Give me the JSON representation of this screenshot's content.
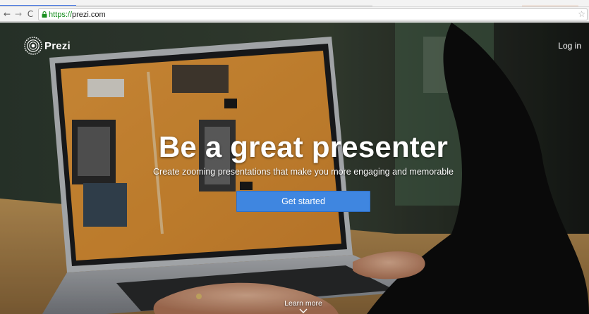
{
  "browser": {
    "url_scheme": "https://",
    "url_host": "prezi.com",
    "back_icon": "back-arrow-icon",
    "forward_icon": "forward-arrow-icon",
    "reload_icon": "reload-icon",
    "lock_icon": "lock-icon",
    "bookmark_icon": "star-icon"
  },
  "site": {
    "logo_text": "Prezi",
    "login_label": "Log in"
  },
  "hero": {
    "headline": "Be a great presenter",
    "subheadline": "Create zooming presentations that make you more engaging and memorable",
    "cta_label": "Get started",
    "learn_more_label": "Learn more"
  },
  "colors": {
    "cta_blue": "#3f86e0",
    "url_green": "#0b8a14",
    "screen_orange": "#e99a38"
  }
}
